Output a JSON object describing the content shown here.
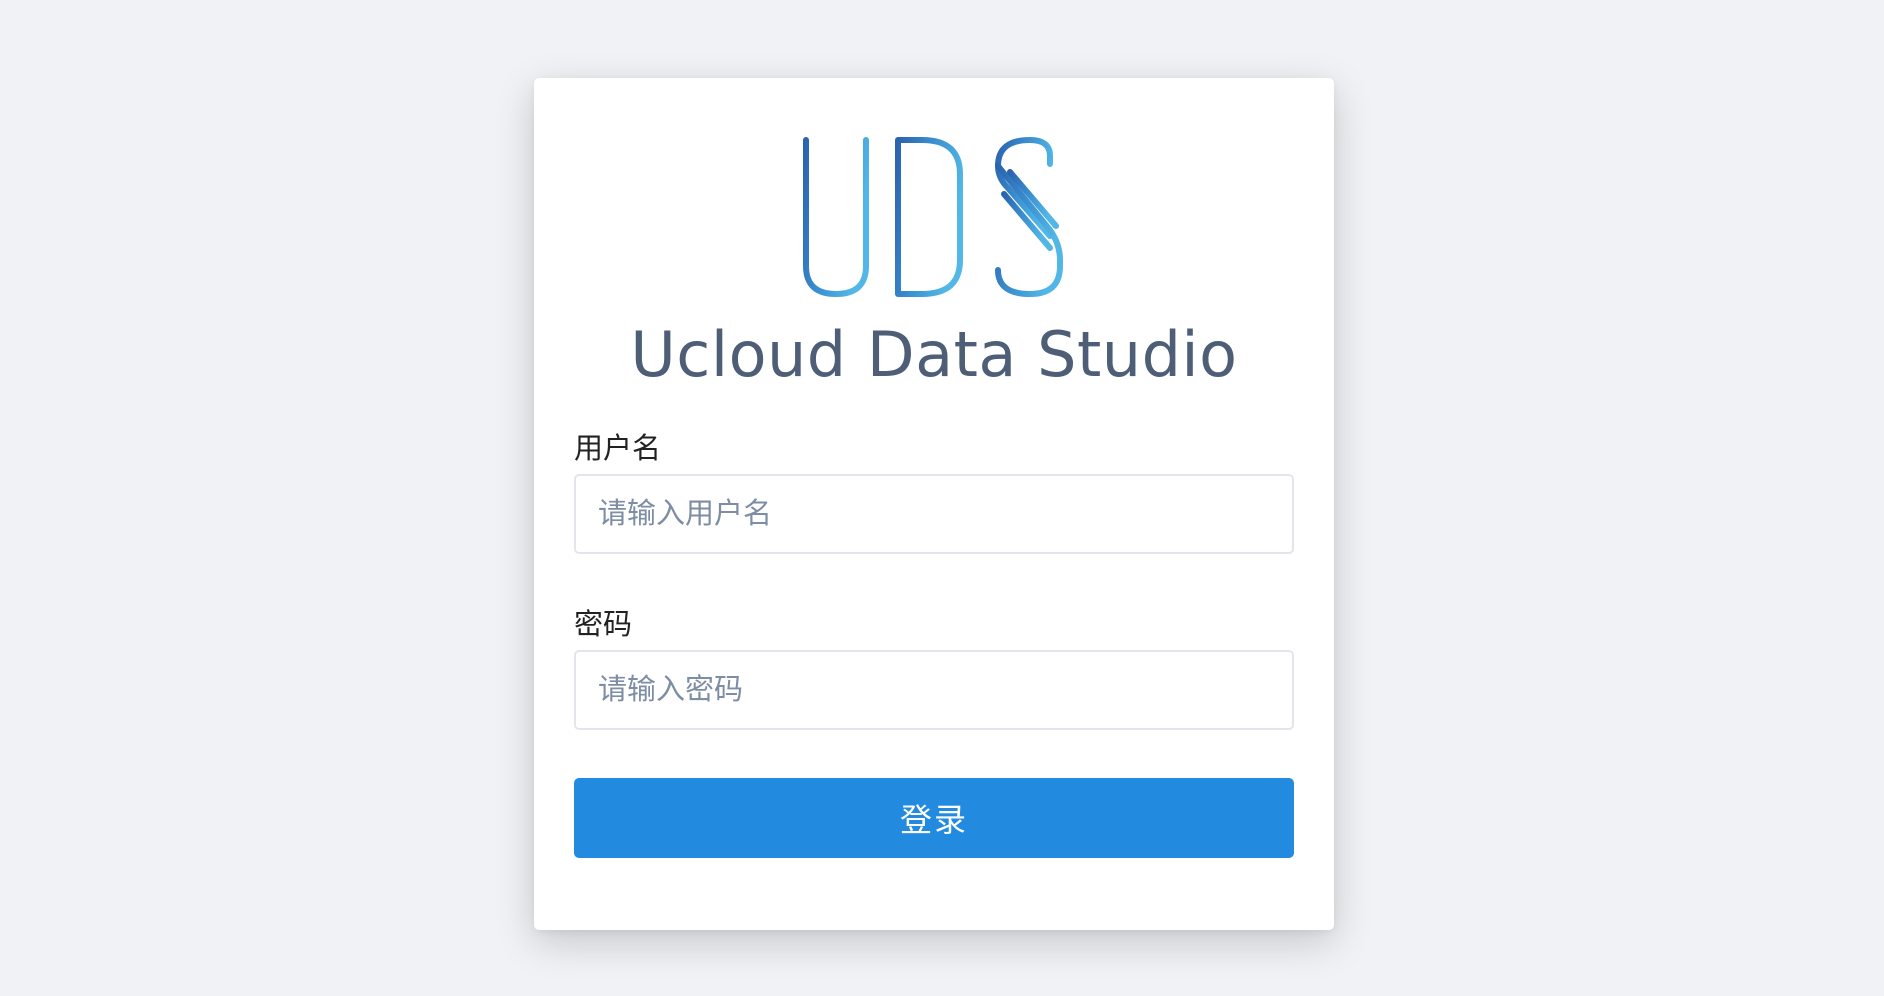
{
  "logo": {
    "icon": "uds-logo-icon",
    "colors": {
      "start": "#2b64ae",
      "mid": "#3a8fd0",
      "end": "#52b7e6"
    }
  },
  "app": {
    "title": "Ucloud Data Studio"
  },
  "form": {
    "username": {
      "label": "用户名",
      "placeholder": "请输入用户名",
      "value": ""
    },
    "password": {
      "label": "密码",
      "placeholder": "请输入密码",
      "value": ""
    },
    "submit_label": "登录"
  },
  "colors": {
    "page_background": "#f0f2f5",
    "primary": "#228be0",
    "title": "#4d5e76"
  }
}
